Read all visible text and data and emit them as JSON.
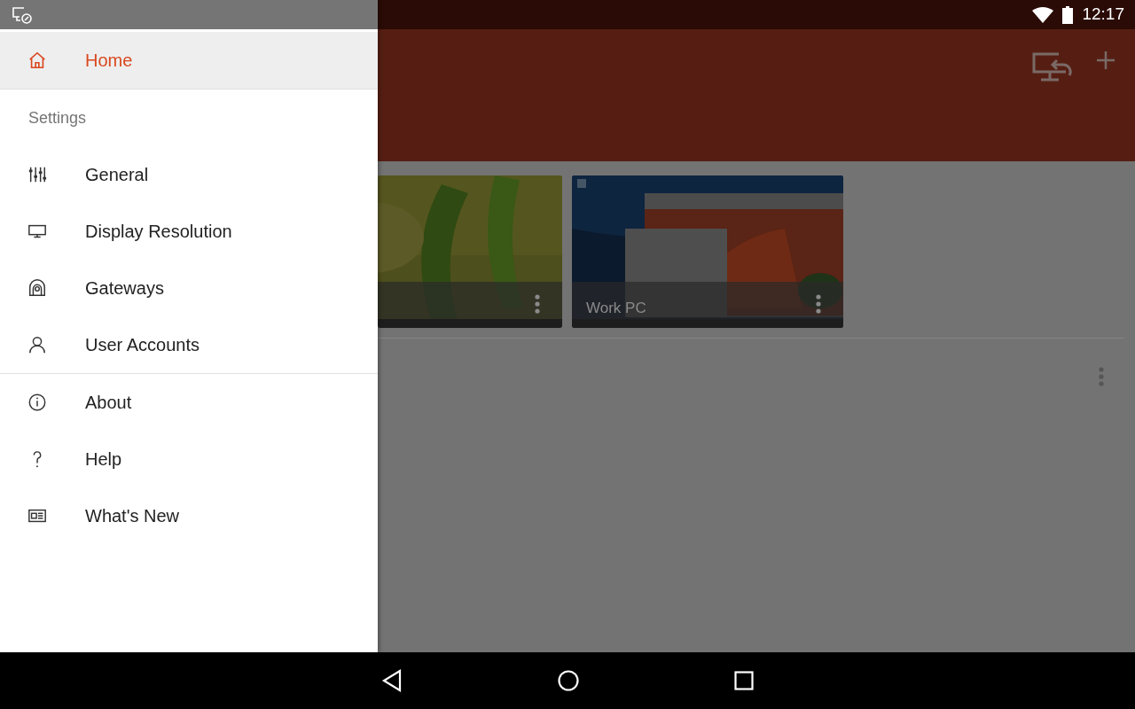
{
  "status_bar": {
    "time": "12:17"
  },
  "drawer": {
    "items": [
      {
        "kind": "item",
        "label": "Home",
        "selected": true
      },
      {
        "kind": "divider"
      },
      {
        "kind": "header",
        "label": "Settings"
      },
      {
        "kind": "item",
        "label": "General",
        "selected": false
      },
      {
        "kind": "item",
        "label": "Display Resolution",
        "selected": false
      },
      {
        "kind": "item",
        "label": "Gateways",
        "selected": false
      },
      {
        "kind": "item",
        "label": "User Accounts",
        "selected": false
      },
      {
        "kind": "divider"
      },
      {
        "kind": "item",
        "label": "About",
        "selected": false
      },
      {
        "kind": "item",
        "label": "Help",
        "selected": false
      },
      {
        "kind": "item",
        "label": "What's New",
        "selected": false
      }
    ]
  },
  "desktops": [
    {
      "kind": "picture"
    },
    {
      "kind": "picture",
      "label": "Work PC"
    }
  ]
}
